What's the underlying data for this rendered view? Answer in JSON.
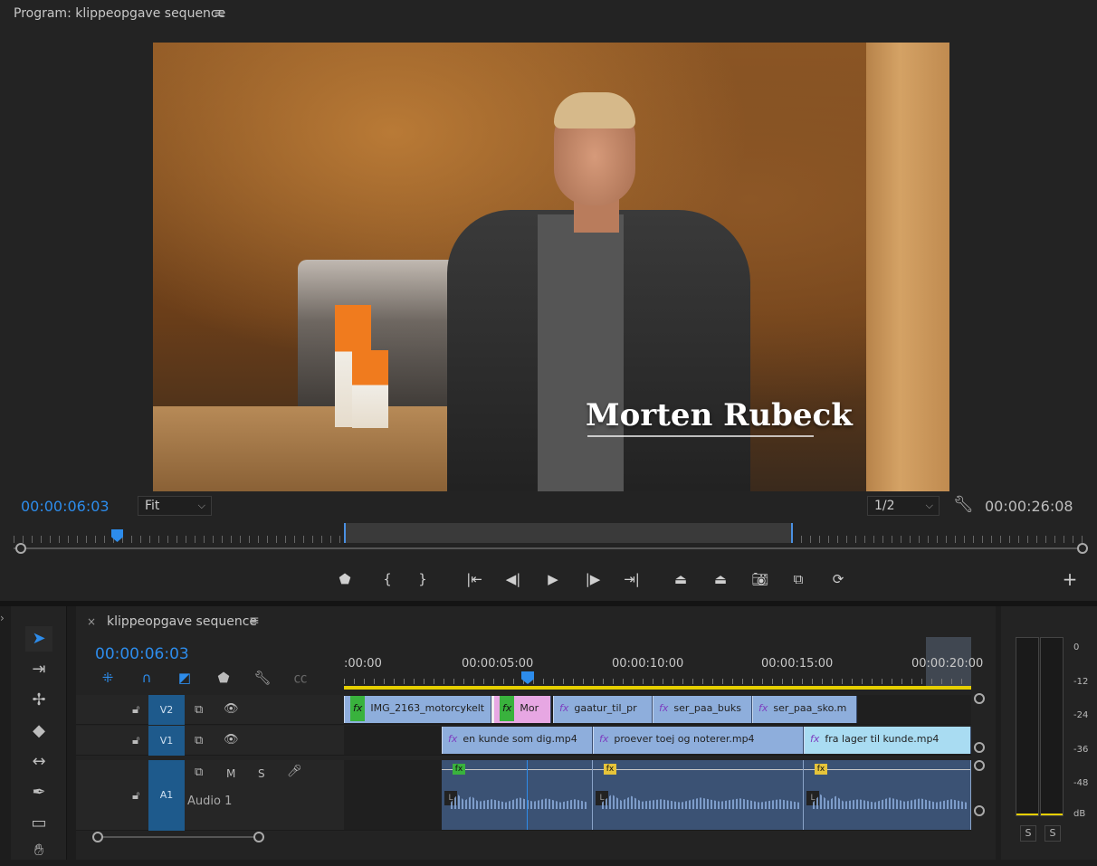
{
  "program": {
    "title": "Program: klippeopgave sequence",
    "menu_icon": "≡",
    "lower_third": "Morten Rubeck",
    "timecode": "00:00:06:03",
    "fit": "Fit",
    "resolution": "1/2",
    "duration": "00:00:26:08"
  },
  "timeline": {
    "close": "×",
    "title": "klippeopgave sequence",
    "menu_icon": "≡",
    "timecode": "00:00:06:03",
    "ruler_labels": [
      ":00:00",
      "00:00:05:00",
      "00:00:10:00",
      "00:00:15:00",
      "00:00:20:00"
    ],
    "tracks": {
      "v2": "V2",
      "v1": "V1",
      "a1": "A1",
      "a1_name": "Audio 1",
      "mute": "M",
      "solo": "S"
    },
    "v2_clips": [
      "IMG_2163_motorcykelt",
      "Mor",
      "gaatur_til_pr",
      "ser_paa_buks",
      "ser_paa_sko.m"
    ],
    "v1_clips": [
      "en  kunde  som  dig.mp4",
      "proever  toej  og  noterer.mp4",
      "fra  lager  til  kunde.mp4"
    ],
    "fx_label": "fx"
  },
  "meter": {
    "db_labels": [
      "0",
      "-12",
      "-24",
      "-36",
      "-48",
      "dB"
    ],
    "solo_left": "S",
    "solo_right": "S"
  },
  "colors": {
    "accent": "#2d8ceb",
    "clip_video": "#8eaedc",
    "clip_pink": "#e7a7e3",
    "clip_cyan": "#a9dcf2",
    "work_area": "#e6cf00"
  }
}
